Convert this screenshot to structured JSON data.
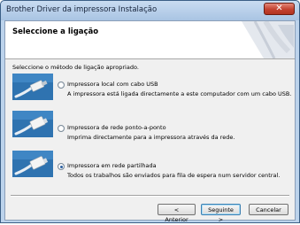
{
  "window": {
    "title": "Brother Driver da impressora Instalação",
    "close_symbol": "✕"
  },
  "header": {
    "title": "Seleccione a ligação"
  },
  "instruction": "Seleccione o método de ligação apropriado.",
  "options": [
    {
      "label": "Impressora local com cabo USB",
      "description": "A impressora está ligada directamente a este computador com um cabo USB.",
      "selected": false,
      "icon": "usb-cable-icon"
    },
    {
      "label": "Impressora de rede  ponto-a-ponto",
      "description": "Imprima directamente para a impressora através da rede.",
      "selected": false,
      "icon": "network-cable-icon"
    },
    {
      "label": "Impressora em rede partilhada",
      "description": "Todos os trabalhos são enviados para fila de espera num servidor central.",
      "selected": true,
      "icon": "network-cable-icon"
    }
  ],
  "buttons": {
    "back": "< Anterior",
    "next": "Seguinte >",
    "cancel": "Cancelar"
  },
  "colors": {
    "accent": "#2a5fa0",
    "title_bar": "#bcd3ec",
    "close": "#c3412f"
  }
}
